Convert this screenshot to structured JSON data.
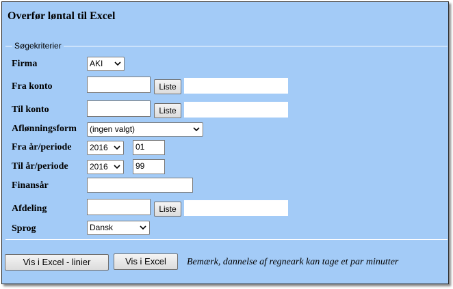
{
  "window": {
    "title": "Overfør løntal til Excel"
  },
  "form": {
    "legend": "Søgekriterier",
    "firma": {
      "label": "Firma",
      "value": "AKI"
    },
    "fra_konto": {
      "label": "Fra konto",
      "value": "",
      "list_button": "Liste",
      "display": ""
    },
    "til_konto": {
      "label": "Til konto",
      "value": "",
      "list_button": "Liste",
      "display": ""
    },
    "afloenningsform": {
      "label": "Aflønningsform",
      "value": "(ingen valgt)"
    },
    "fra_aar_periode": {
      "label": "Fra år/periode",
      "year": "2016",
      "period": "01"
    },
    "til_aar_periode": {
      "label": "Til år/periode",
      "year": "2016",
      "period": "99"
    },
    "finansaar": {
      "label": "Finansår",
      "value": ""
    },
    "afdeling": {
      "label": "Afdeling",
      "value": "",
      "list_button": "Liste",
      "display": ""
    },
    "sprog": {
      "label": "Sprog",
      "value": "Dansk"
    }
  },
  "actions": {
    "excel_lines_button": "Vis i Excel - linier",
    "excel_button": "Vis i Excel",
    "note": "Bemærk, dannelse af regneark kan tage et par minutter"
  }
}
